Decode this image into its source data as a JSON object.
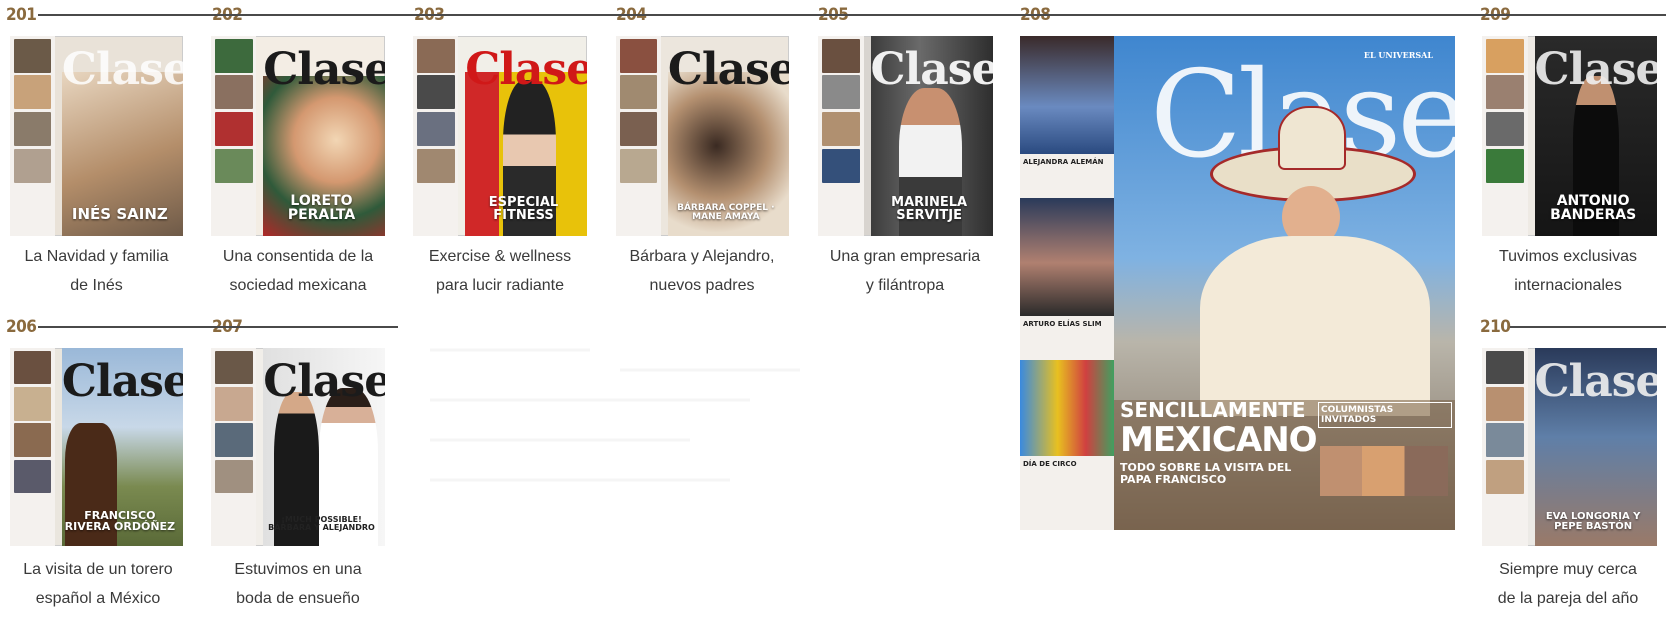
{
  "issues": [
    {
      "number": "201",
      "brand": "Clase",
      "headline": "INÉS SAINZ",
      "caption": [
        "La Navidad y familia",
        "de Inés"
      ],
      "color": "#7a6a55"
    },
    {
      "number": "202",
      "brand": "Clase",
      "headline": "LORETO PERALTA",
      "caption": [
        "Una consentida de la",
        "sociedad mexicana"
      ],
      "color": "#2f5a3a"
    },
    {
      "number": "203",
      "brand": "Clase",
      "headline": "ESPECIAL FITNESS",
      "caption": [
        "Exercise & wellness",
        "para lucir radiante"
      ],
      "color": "#e8c20a"
    },
    {
      "number": "204",
      "brand": "Clase",
      "headline": "BÁRBARA COPPEL · MANE AMAYA",
      "caption": [
        "Bárbara y Alejandro,",
        "nuevos padres"
      ],
      "color": "#b49070"
    },
    {
      "number": "205",
      "brand": "Clase",
      "headline": "MARINELA SERVITJE",
      "caption": [
        "Una gran empresaria",
        "y filántropa"
      ],
      "color": "#3a3a3a"
    },
    {
      "number": "206",
      "brand": "Clase",
      "headline": "FRANCISCO RIVERA ORDÓÑEZ",
      "caption": [
        "La visita de un torero",
        "español a México"
      ],
      "color": "#7fa0c0"
    },
    {
      "number": "207",
      "brand": "Clase",
      "headline": "¡MUCH POSSIBLE! BÁRBARA Y ALEJANDRO",
      "caption": [
        "Estuvimos en una",
        "boda de ensueño"
      ],
      "color": "#e6e6e6"
    },
    {
      "number": "209",
      "brand": "Clase",
      "headline": "ANTONIO BANDERAS",
      "caption": [
        "Tuvimos exclusivas",
        "internacionales"
      ],
      "color": "#1e1e1e"
    },
    {
      "number": "210",
      "brand": "Clase",
      "headline": "EVA LONGORIA Y PEPE BASTÓN",
      "caption": [
        "Siempre muy cerca",
        "de la pareja del año"
      ],
      "color": "#5f7fa8"
    }
  ],
  "featured": {
    "number": "208",
    "brand": "Clase",
    "publisher": "EL UNIVERSAL",
    "headline_small": "SENCILLAMENTE",
    "headline_big": "MEXICANO",
    "subhead": "TODO SOBRE LA VISITA DEL PAPA FRANCISCO",
    "side_items": [
      "ALEJANDRA ALEMÁN",
      "ARTURO ELÍAS SLIM",
      "DÍA DE CIRCO"
    ],
    "columnists": "COLUMNISTAS INVITADOS",
    "sky": "#4b8fd0"
  }
}
